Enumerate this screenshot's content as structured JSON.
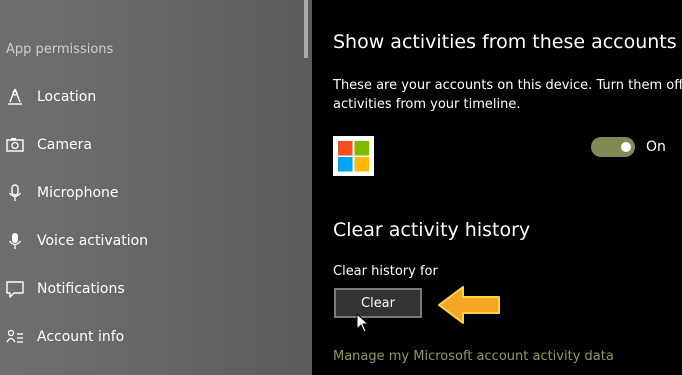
{
  "sidebar": {
    "section_title": "App permissions",
    "items": [
      {
        "label": "Location",
        "icon": "location-icon"
      },
      {
        "label": "Camera",
        "icon": "camera-icon"
      },
      {
        "label": "Microphone",
        "icon": "microphone-icon"
      },
      {
        "label": "Voice activation",
        "icon": "voice-activation-icon"
      },
      {
        "label": "Notifications",
        "icon": "notifications-icon"
      },
      {
        "label": "Account info",
        "icon": "account-info-icon"
      }
    ]
  },
  "main": {
    "accounts_heading": "Show activities from these accounts",
    "accounts_desc_line1": "These are your accounts on this device. Turn them off to",
    "accounts_desc_line2": "activities from your timeline.",
    "account_toggle": {
      "state_label": "On",
      "on": true
    },
    "clear_heading": "Clear activity history",
    "clear_subheading": "Clear history for",
    "clear_button": "Clear",
    "manage_link": "Manage my Microsoft account activity data"
  },
  "colors": {
    "toggle_on": "#7e8b52",
    "link": "#8a9a5b",
    "annotation_arrow": "#f5a623",
    "ms_red": "#f25022",
    "ms_green": "#7fba00",
    "ms_blue": "#00a4ef",
    "ms_yellow": "#ffb900"
  }
}
